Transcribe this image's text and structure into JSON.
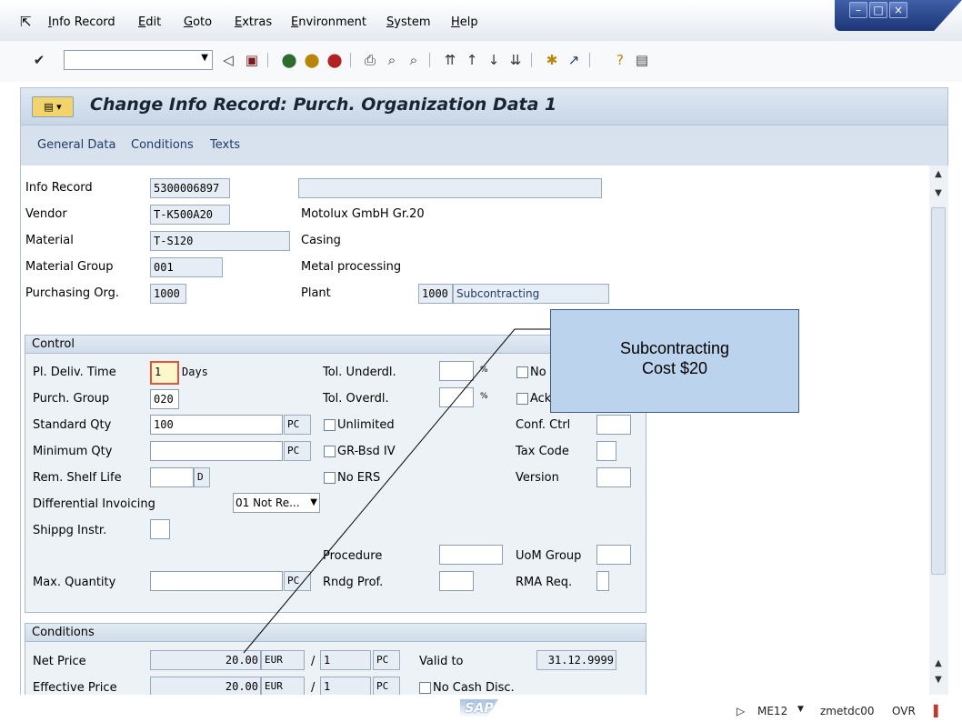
{
  "menu": [
    "Info Record",
    "Edit",
    "Goto",
    "Extras",
    "Environment",
    "System",
    "Help"
  ],
  "toolbar": {
    "command_value": ""
  },
  "title": "Change Info Record: Purch. Organization Data 1",
  "app_buttons": [
    "General Data",
    "Conditions",
    "Texts"
  ],
  "header": {
    "info_record_label": "Info Record",
    "info_record": "5300006897",
    "vendor_label": "Vendor",
    "vendor": "T-K500A20",
    "vendor_name": "Motolux GmbH Gr.20",
    "material_label": "Material",
    "material": "T-S120",
    "material_desc": "Casing",
    "material_group_label": "Material Group",
    "material_group": "001",
    "material_group_desc": "Metal processing",
    "purch_org_label": "Purchasing Org.",
    "purch_org": "1000",
    "plant_label": "Plant",
    "plant": "1000",
    "plant_desc": "Subcontracting"
  },
  "control": {
    "title": "Control",
    "pl_deliv_time_label": "Pl. Deliv. Time",
    "pl_deliv_time": "1",
    "days": "Days",
    "purch_group_label": "Purch. Group",
    "purch_group": "020",
    "standard_qty_label": "Standard Qty",
    "standard_qty": "100",
    "standard_qty_unit": "PC",
    "minimum_qty_label": "Minimum Qty",
    "minimum_qty_unit": "PC",
    "shelf_life_label": "Rem. Shelf Life",
    "shelf_life_unit": "D",
    "diff_invoicing_label": "Differential Invoicing",
    "diff_invoicing_value": "01 Not Re...",
    "shipping_label": "Shippg Instr.",
    "max_qty_label": "Max. Quantity",
    "max_qty_unit": "PC",
    "tol_underdl_label": "Tol. Underdl.",
    "tol_overdl_label": "Tol. Overdl.",
    "percent": "%",
    "unlimited_label": "Unlimited",
    "grbsd_label": "GR-Bsd IV",
    "no_ers_label": "No ERS",
    "procedure_label": "Procedure",
    "rndg_prof_label": "Rndg Prof.",
    "no_label": "No",
    "ack_label": "Ack",
    "conf_ctrl_label": "Conf. Ctrl",
    "tax_code_label": "Tax Code",
    "version_label": "Version",
    "uom_group_label": "UoM Group",
    "rma_req_label": "RMA Req."
  },
  "conditions": {
    "title": "Conditions",
    "net_price_label": "Net Price",
    "net_price": "20.00",
    "net_currency": "EUR",
    "slash": "/",
    "net_per": "1",
    "net_unit": "PC",
    "valid_to_label": "Valid to",
    "valid_to": "31.12.9999",
    "eff_price_label": "Effective Price",
    "eff_price": "20.00",
    "eff_currency": "EUR",
    "eff_per": "1",
    "eff_unit": "PC",
    "no_cash_disc_label": "No Cash Disc."
  },
  "annotation": "Subcontracting\nCost $20",
  "status": {
    "tcode": "ME12",
    "server": "zmetdc00",
    "mode": "OVR",
    "logo": "SAP"
  },
  "colors": {
    "accent": "#1f3b66",
    "callout_fill": "#bcd3ee",
    "window_control": "#2c4790"
  }
}
